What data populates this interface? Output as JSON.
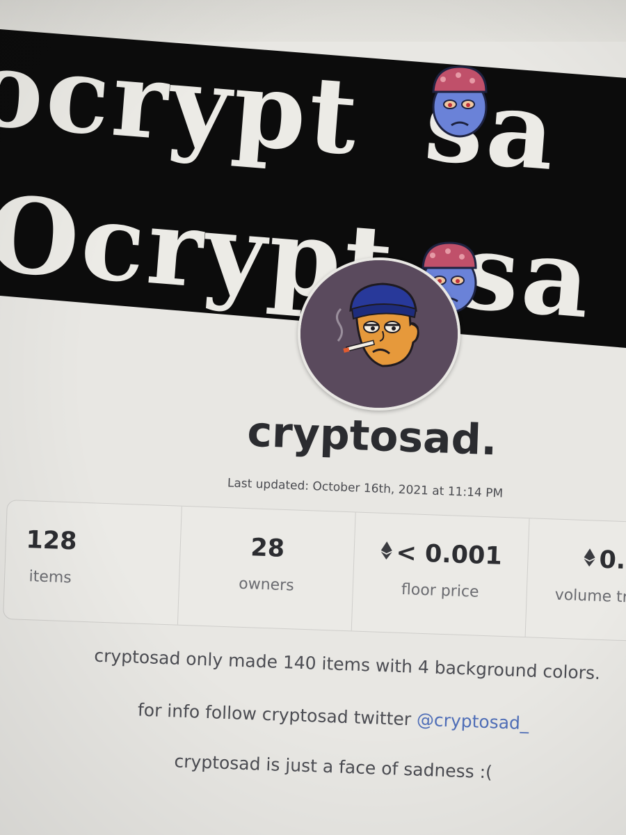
{
  "banner": {
    "line1": "ocrypt",
    "line1_tail": "sa",
    "line2": "Ocrypt",
    "line2_tail": "sa"
  },
  "profile": {
    "name": "cryptosad.",
    "last_updated": "Last updated: October 16th, 2021 at 11:14 PM"
  },
  "stats": [
    {
      "value": "128",
      "label": "items"
    },
    {
      "value": "28",
      "label": "owners"
    },
    {
      "value": "< 0.001",
      "label": "floor price",
      "icon": "ethereum-icon"
    },
    {
      "value": "0.",
      "label": "volume tr",
      "icon": "ethereum-icon"
    }
  ],
  "description": {
    "line1": "cryptosad only made 140 items with 4 background colors.",
    "line2_prefix": "for info follow cryptosad twitter ",
    "line2_link": "@cryptosad_",
    "line3": "cryptosad is just a face of sadness :("
  },
  "colors": {
    "banner_bg": "#0c0c0c",
    "avatar_bg": "#5a4a5d",
    "link": "#4f6eb7",
    "text_dark": "#2c2d31"
  }
}
